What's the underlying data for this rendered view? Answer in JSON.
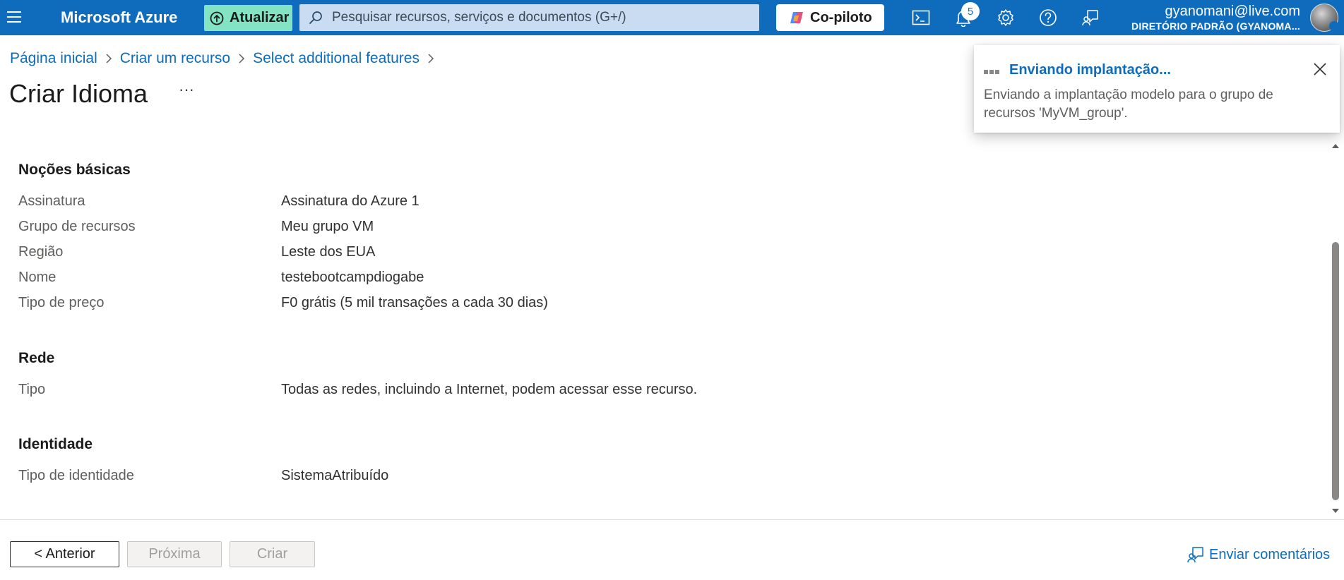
{
  "topbar": {
    "brand": "Microsoft Azure",
    "upgrade_label": "Atualizar",
    "search_placeholder": "Pesquisar recursos, serviços e documentos (G+/)",
    "copilot_label": "Co-piloto",
    "notification_count": "5",
    "account_email": "gyanomani@live.com",
    "account_directory": "DIRETÓRIO PADRÃO (GYANOMA..."
  },
  "breadcrumb": [
    "Página inicial",
    "Criar um recurso",
    "Select additional features"
  ],
  "page": {
    "title": "Criar Idioma",
    "more_label": "···"
  },
  "sections": {
    "basics": {
      "title": "Noções básicas",
      "rows": [
        {
          "label": "Assinatura",
          "value": "Assinatura do Azure 1"
        },
        {
          "label": "Grupo de recursos",
          "value": "Meu grupo VM"
        },
        {
          "label": "Região",
          "value": "Leste dos EUA"
        },
        {
          "label": "Nome",
          "value": "testebootcampdiogabe"
        },
        {
          "label": "Tipo de preço",
          "value": "F0 grátis (5 mil transações a cada 30 dias)"
        }
      ]
    },
    "network": {
      "title": "Rede",
      "rows": [
        {
          "label": "Tipo",
          "value": "Todas as redes, incluindo a Internet, podem acessar esse recurso."
        }
      ]
    },
    "identity": {
      "title": "Identidade",
      "rows": [
        {
          "label": "Tipo de identidade",
          "value": "SistemaAtribuído"
        }
      ]
    }
  },
  "footer": {
    "previous_label": "< Anterior",
    "next_label": "Próxima",
    "create_label": "Criar",
    "feedback_label": "Enviar comentários"
  },
  "notification": {
    "title": "Enviando implantação...",
    "body": "Enviando a implantação modelo para o grupo de recursos 'MyVM_group'."
  },
  "colors": {
    "topbar": "#0f6cbd",
    "upgrade_button": "#83e4c4",
    "link": "#0f6cbd"
  }
}
